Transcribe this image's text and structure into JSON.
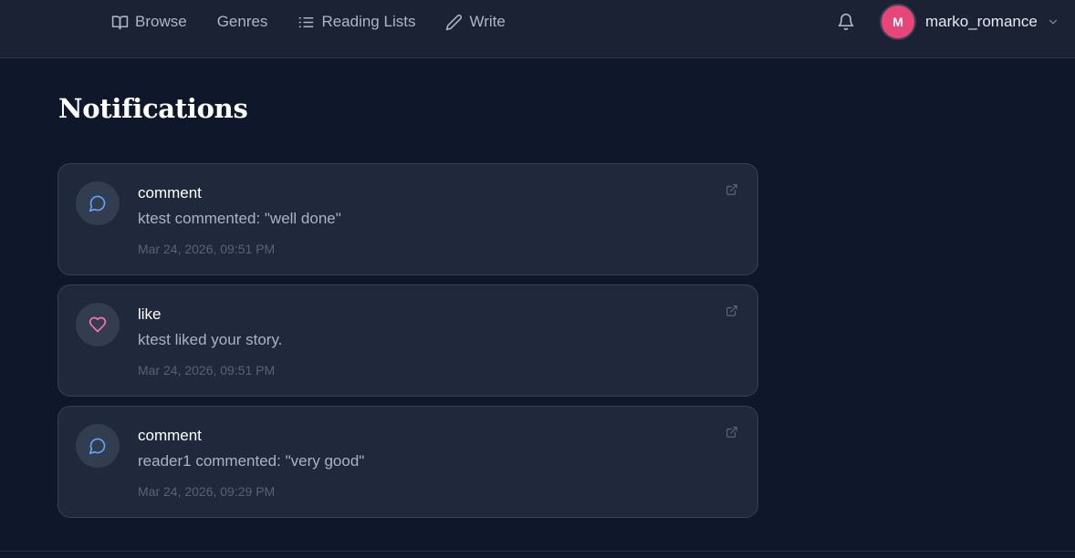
{
  "nav": {
    "items": [
      {
        "label": "Browse",
        "icon": "book-open-icon"
      },
      {
        "label": "Genres",
        "icon": ""
      },
      {
        "label": "Reading Lists",
        "icon": "list-icon"
      },
      {
        "label": "Write",
        "icon": "pencil-icon"
      }
    ]
  },
  "header": {
    "bell_icon": "bell-icon",
    "user": {
      "avatar_initial": "M",
      "username": "marko_romance",
      "avatar_color": "#e8457a"
    }
  },
  "page": {
    "title": "Notifications"
  },
  "notifications": [
    {
      "type": "comment",
      "message": "ktest commented: \"well done\"",
      "time": "Mar 24, 2026, 09:51 PM",
      "icon": "comment-icon",
      "icon_color": "#60a5fa"
    },
    {
      "type": "like",
      "message": "ktest liked your story.",
      "time": "Mar 24, 2026, 09:51 PM",
      "icon": "heart-icon",
      "icon_color": "#f472b6"
    },
    {
      "type": "comment",
      "message": "reader1 commented: \"very good\"",
      "time": "Mar 24, 2026, 09:29 PM",
      "icon": "comment-icon",
      "icon_color": "#60a5fa"
    }
  ],
  "colors": {
    "background": "#0f172a",
    "card": "#1f293b",
    "accent_blue": "#60a5fa",
    "accent_pink": "#f472b6"
  }
}
